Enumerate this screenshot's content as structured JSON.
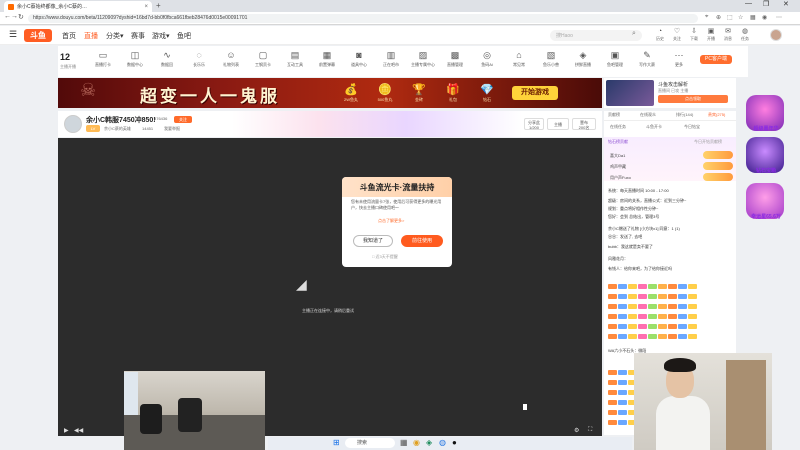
{
  "browser": {
    "tab_title": "余小C蔡始终都像_余小C蔡的…",
    "tab_close": "×",
    "new_tab": "+",
    "url": "https://www.douyu.com/beta/1120909?dyshid=16bd7d-bb0f0fbca661fbeb28476d0015e00091701",
    "controls": [
      "—",
      "❐",
      "✕"
    ]
  },
  "header": {
    "logo": "斗鱼",
    "nav": [
      "首页",
      "直播",
      "分类▾",
      "赛事",
      "游戏▾",
      "鱼吧"
    ],
    "active_nav": "直播",
    "search_placeholder": "搜Haoo",
    "icons": [
      {
        "glyph": "◔",
        "label": "历史"
      },
      {
        "glyph": "♡",
        "label": "关注"
      },
      {
        "glyph": "⇩",
        "label": "下载"
      },
      {
        "glyph": "▣",
        "label": "开播"
      },
      {
        "glyph": "✉",
        "label": "消息"
      },
      {
        "glyph": "◍",
        "label": "任务"
      }
    ]
  },
  "live_count": {
    "number": "12",
    "label": "主播开播"
  },
  "categories": [
    {
      "glyph": "▭",
      "label": "直播打卡"
    },
    {
      "glyph": "◫",
      "label": "数据中心"
    },
    {
      "glyph": "∿",
      "label": "数据回"
    },
    {
      "glyph": "◌",
      "label": "长乐乐"
    },
    {
      "glyph": "☺",
      "label": "礼物列表"
    },
    {
      "glyph": "▢",
      "label": "工钢贡卡"
    },
    {
      "glyph": "▤",
      "label": "互动工具"
    },
    {
      "glyph": "▦",
      "label": "前置弹幕"
    },
    {
      "glyph": "◙",
      "label": "道具中心"
    },
    {
      "glyph": "▥",
      "label": "正在吧市"
    },
    {
      "glyph": "▨",
      "label": "主播专属中心"
    },
    {
      "glyph": "▩",
      "label": "直播管理"
    },
    {
      "glyph": "◎",
      "label": "鱼码Ai"
    },
    {
      "glyph": "⌂",
      "label": "常见常"
    },
    {
      "glyph": "▧",
      "label": "鱼乐小兽"
    },
    {
      "glyph": "◈",
      "label": "拼鲜直播"
    },
    {
      "glyph": "▣",
      "label": "鱼吧管理"
    },
    {
      "glyph": "✎",
      "label": "写作大赛"
    },
    {
      "glyph": "⋯",
      "label": "更多"
    }
  ],
  "pc_client": "PC客户端",
  "banner": {
    "title": "超变一人一鬼服",
    "prizes": [
      {
        "glyph": "💰",
        "label": "2W鱼丸"
      },
      {
        "glyph": "🪙",
        "label": "500鱼丸"
      },
      {
        "glyph": "🏆",
        "label": "金砖"
      },
      {
        "glyph": "🎁",
        "label": "礼包"
      },
      {
        "glyph": "💎",
        "label": "钻石"
      }
    ],
    "button": "开始游戏"
  },
  "game_card": {
    "title": "斗鱼攻击解析",
    "sub": "直播间 已攻 主播",
    "button": "点击领取"
  },
  "streamer": {
    "title": "余小C韩服7450冲850!",
    "follow": "关注",
    "follower_count": "376436",
    "tag": "LV",
    "room": "余小C蔡的英雄",
    "views": "14451",
    "report": "我要举报",
    "btn_share_top": "分享此",
    "btn_share_bottom": "1/200",
    "btn_follow_label": "主播",
    "btn_follow_top": "壹布",
    "btn_follow_bottom": "200名"
  },
  "dialog": {
    "title": "斗鱼流光卡·流量扶持",
    "text": "您有未使用流量卡7张，使用后可获得更多的曝光用户，快去主播口碑使用吧～",
    "link": "点击了解更多>",
    "cancel": "我知道了",
    "confirm": "前往使用",
    "checkbox": "□ 近3天不提醒"
  },
  "player": {
    "hint": "主播正在连接中，请稍后重试",
    "controls": [
      "▶",
      "◀◀",
      "⛶",
      "⚙"
    ]
  },
  "right_panel": {
    "tabs": [
      "贡献榜",
      "在线观众",
      "排行(144)",
      "贵宾(275)"
    ],
    "active_tab": "贵宾(275)",
    "subtabs": [
      "在线任务",
      "斗鱼开卡",
      "今日钻宝"
    ],
    "rank_header": "钻石榜贡献",
    "rank_header_right": "今日开钻贡献榜",
    "rank_rows": [
      "喜大Da1",
      "鸡声甲藏",
      "用户声Fuxo"
    ],
    "chat": [
      "系统：每天直播时间 10:00 - 17:00",
      "超级：房间的关系，直播公式：近到三分钟~",
      "规划：重点将好相作性分钟~",
      "您好：会到 总结出，管理3号",
      "余小C赠送了礼物 [小方块x1] 同意：1 (1)",
      "谷谷：发送了, 去吧",
      "bubb：我这就是卖不要了",
      "风雅花月：",
      "有钱人：给你来吧，为了给你接近吗",
      "WA六小不石头：微段"
    ]
  },
  "gifts": [
    {
      "label": "超级嘉年华"
    },
    {
      "label": "钻石宝箱"
    },
    {
      "label": "幸运星65.6万"
    }
  ],
  "taskbar": {
    "search": "搜索",
    "icons": [
      "⊞",
      "▦",
      "◉",
      "◈",
      "◍",
      "●"
    ]
  },
  "colors": {
    "accent": "#ff5d23",
    "banner": "#8a1a12",
    "confirm": "#ff5b1f"
  }
}
